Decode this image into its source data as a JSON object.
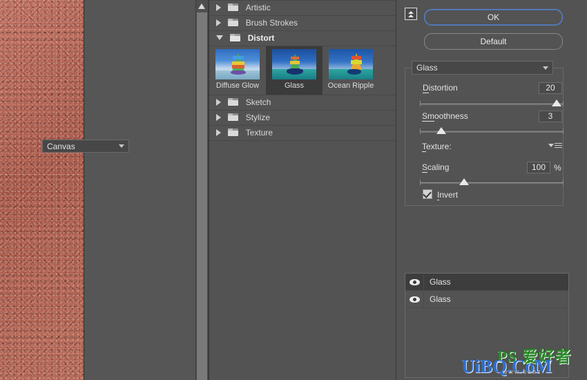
{
  "preview": {
    "name": "filter-preview",
    "scroll_up_icon": "triangle-up-icon"
  },
  "filter_browser": {
    "categories": [
      {
        "label": "Artistic",
        "expanded": false,
        "icon": "folder-closed-icon",
        "arrow": "triangle-right-icon"
      },
      {
        "label": "Brush Strokes",
        "expanded": false,
        "icon": "folder-closed-icon",
        "arrow": "triangle-right-icon"
      },
      {
        "label": "Distort",
        "expanded": true,
        "icon": "folder-open-icon",
        "arrow": "triangle-down-icon"
      },
      {
        "label": "Sketch",
        "expanded": false,
        "icon": "folder-closed-icon",
        "arrow": "triangle-right-icon"
      },
      {
        "label": "Stylize",
        "expanded": false,
        "icon": "folder-closed-icon",
        "arrow": "triangle-right-icon"
      },
      {
        "label": "Texture",
        "expanded": false,
        "icon": "folder-closed-icon",
        "arrow": "triangle-right-icon"
      }
    ],
    "thumbnails": [
      {
        "label": "Diffuse Glow",
        "selected": false
      },
      {
        "label": "Glass",
        "selected": true
      },
      {
        "label": "Ocean Ripple",
        "selected": false
      }
    ]
  },
  "settings": {
    "collapse_icon": "double-chevron-up-icon",
    "ok_label": "OK",
    "default_label": "Default",
    "ok_border_color": "#5a83c4",
    "filter_select": {
      "value": "Glass",
      "chevron_icon": "chevron-down-icon"
    },
    "controls": [
      {
        "label": "Distortion",
        "value": "20",
        "underline": "D",
        "slider_percent": 95
      },
      {
        "label": "Smoothness",
        "value": "3",
        "underline": "Sm",
        "slider_percent": 15
      }
    ],
    "texture": {
      "label": "Texture:",
      "value": "Canvas",
      "chevron_icon": "chevron-down-icon",
      "menu_icon": "flyout-menu-icon"
    },
    "scaling": {
      "label": "Scaling",
      "value": "100",
      "unit": "%",
      "slider_percent": 31
    },
    "invert": {
      "label": "Invert",
      "checked": true,
      "check_icon": "checkmark-icon"
    }
  },
  "layers": {
    "rows": [
      {
        "name": "Glass",
        "visible": true,
        "selected": true,
        "eye_icon": "eye-icon"
      },
      {
        "name": "Glass",
        "visible": true,
        "selected": false,
        "eye_icon": "eye-icon"
      }
    ]
  },
  "watermark": {
    "logo": "PS 爱好者",
    "site": "UiBQ.CoM",
    "small": "www.seez"
  }
}
